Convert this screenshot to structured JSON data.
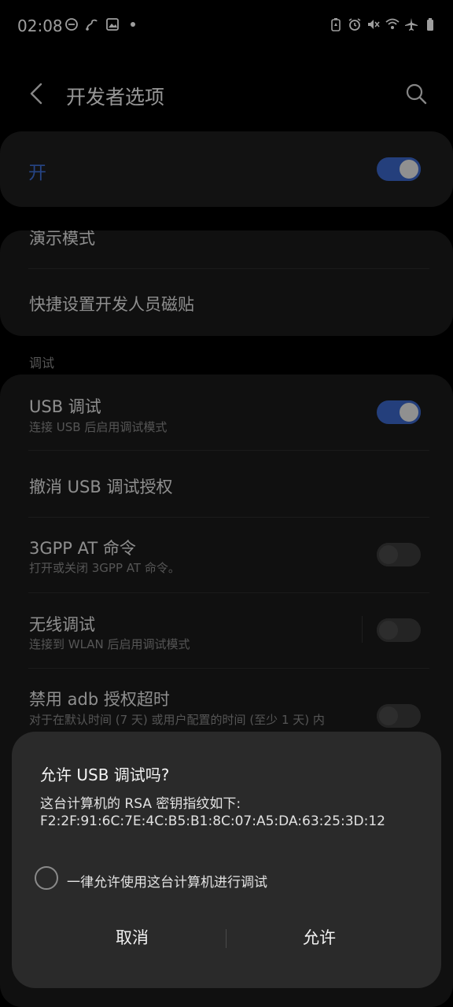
{
  "status_bar": {
    "time": "02:08",
    "left_icons": [
      "do-not-disturb-icon",
      "flow-icon",
      "image-icon",
      "dot-icon"
    ],
    "right_icons": [
      "battery-saver-icon",
      "alarm-icon",
      "mute-icon",
      "wifi-icon",
      "airplane-icon",
      "battery-icon"
    ]
  },
  "app_bar": {
    "title": "开发者选项"
  },
  "master_switch": {
    "label": "开",
    "state": "on"
  },
  "group_top": {
    "items": [
      {
        "title": "演示模式"
      },
      {
        "title": "快捷设置开发人员磁贴"
      }
    ]
  },
  "debug_section": {
    "header": "调试",
    "items": [
      {
        "title": "USB 调试",
        "subtitle": "连接 USB 后启用调试模式",
        "toggle": "on"
      },
      {
        "title": "撤消 USB 调试授权"
      },
      {
        "title": "3GPP AT 命令",
        "subtitle": "打开或关闭 3GPP AT 命令。",
        "toggle": "off"
      },
      {
        "title": "无线调试",
        "subtitle": "连接到 WLAN 后启用调试模式",
        "toggle": "off"
      },
      {
        "title": "禁用 adb 授权超时",
        "subtitle": "对于在默认时间 (7 天) 或用户配置的时间 (至少 1 天) 内",
        "toggle": "off"
      }
    ]
  },
  "dialog": {
    "title": "允许 USB 调试吗?",
    "body_line1": "这台计算机的 RSA 密钥指纹如下:",
    "body_line2": "F2:2F:91:6C:7E:4C:B5:B1:8C:07:A5:DA:63:25:3D:12",
    "checkbox_label": "一律允许使用这台计算机进行调试",
    "cancel_label": "取消",
    "allow_label": "允许"
  },
  "colors": {
    "accent": "#3a66c8",
    "background": "#000000",
    "card": "#1a1a1a",
    "dialog": "#2a2a2a"
  }
}
